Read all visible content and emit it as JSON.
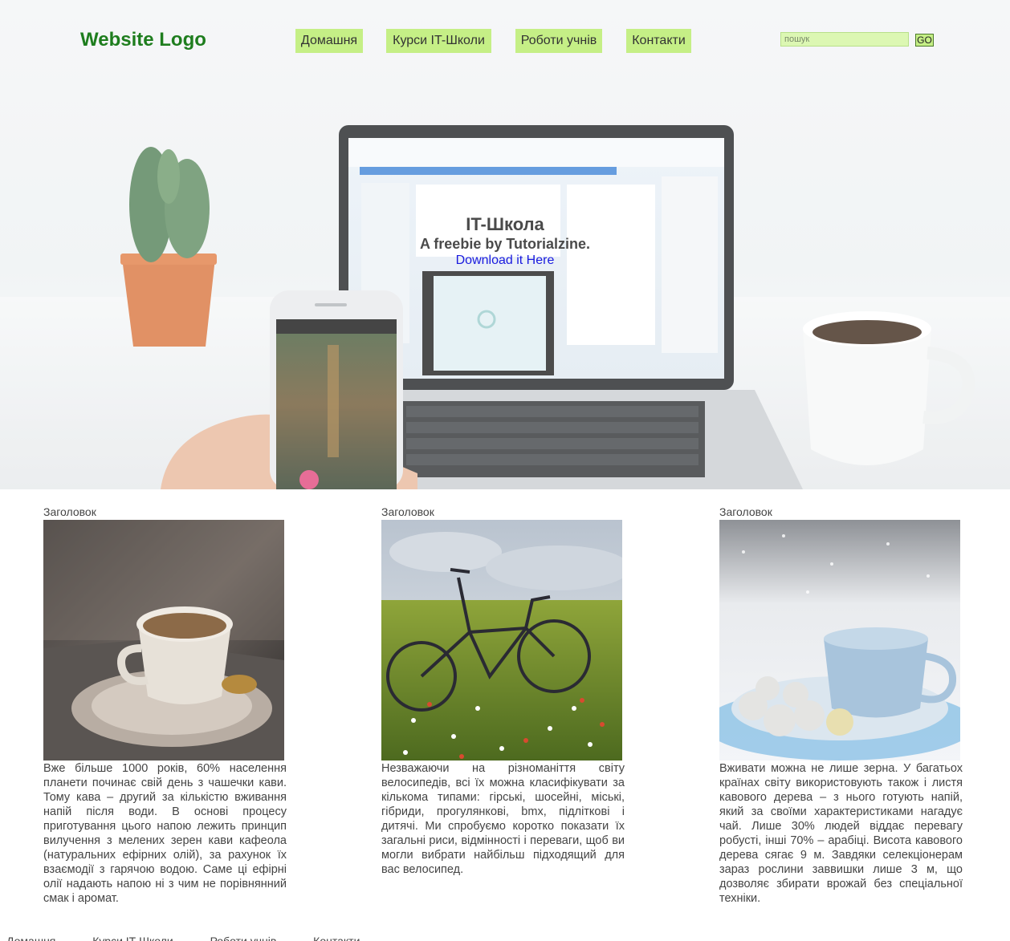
{
  "header": {
    "logo": "Website Logo",
    "nav": [
      {
        "label": "Домашня"
      },
      {
        "label": "Курси IT-Школи"
      },
      {
        "label": "Роботи учнів"
      },
      {
        "label": "Контакти"
      }
    ],
    "search": {
      "placeholder": "пошук",
      "button_label": "GO"
    }
  },
  "hero": {
    "title": "IT-Школа",
    "subtitle": "A freebie by Tutorialzine.",
    "link": "Download it Here"
  },
  "columns": [
    {
      "heading": "Заголовок",
      "image": "coffee-cup-photo",
      "text": "Вже більше 1000 років, 60% населення планети починає свій день з чашечки кави. Тому кава – другий за кількістю вживання напій після води. В основі процесу приготування цього напою лежить принцип вилучення з мелених зерен кави кафеола (натуральних ефірних олій), за рахунок їх взаємодії з гарячою водою. Саме ці ефірні олії надають напою ні з чим не порівнянний смак і аромат."
    },
    {
      "heading": "Заголовок",
      "image": "bicycle-in-field-photo",
      "text": "Незважаючи на різноманіття світу велосипедів, всі їх можна класифікувати за кількома типами: гірські, шосейні, міські, гібриди, прогулянкові, bmx, підліткові і дитячі. Ми спробуємо коротко показати їх загальні риси, відмінності і переваги, щоб ви могли вибрати найбільш підходящий для вас велосипед."
    },
    {
      "heading": "Заголовок",
      "image": "winter-cup-photo",
      "text": "Вживати можна не лише зерна. У багатьох країнах світу використовують також і листя кавового дерева – з нього готують напій, який за своїми характеристиками нагадує чай. Лише 30% людей віддає перевагу робусті, інші 70% – арабіці. Висота кавового дерева сягає 9 м. Завдяки селекціонерам зараз рослини заввишки лише 3 м, що дозволяє збирати врожай без спеціальної техніки."
    }
  ],
  "footer": {
    "nav": [
      "Домашня",
      "Курси IT-Школи",
      "Роботи учнів",
      "Контакти"
    ]
  },
  "colors": {
    "logo": "#1e7d1e",
    "nav_bg": "#c5ef86",
    "link": "#1a1adf"
  }
}
